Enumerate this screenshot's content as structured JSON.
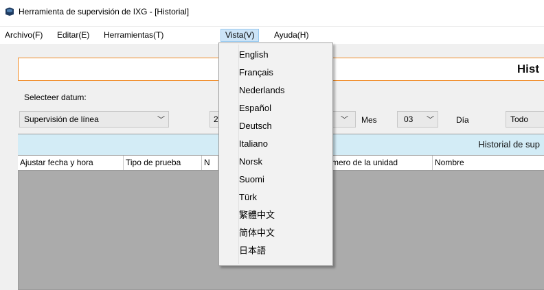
{
  "window": {
    "title": "Herramienta de supervisión de IXG - [Historial]",
    "icon": "app-icon"
  },
  "menubar": {
    "items": [
      {
        "label": "Archivo(F)"
      },
      {
        "label": "Editar(E)"
      },
      {
        "label": "Herramientas(T)"
      },
      {
        "label": "Vista(V)",
        "open": true
      },
      {
        "label": "Ayuda(H)"
      }
    ]
  },
  "language_menu": {
    "items": [
      "English",
      "Français",
      "Nederlands",
      "Español",
      "Deutsch",
      "Italiano",
      "Norsk",
      "Suomi",
      "Türk",
      "繁體中文",
      "简体中文",
      "日本語"
    ]
  },
  "banner": {
    "title": "Hist"
  },
  "filters": {
    "select_date_label": "Selecteer datum:",
    "type_value": "Supervisión de línea",
    "year_value": "2",
    "month_label": "Mes",
    "month_value": "03",
    "day_label": "Día",
    "day_value": "Todo"
  },
  "grid": {
    "caption": "Historial de sup",
    "columns": [
      "Ajustar fecha y hora",
      "Tipo de prueba",
      "N",
      "mero de la unidad",
      "Nombre"
    ]
  },
  "colors": {
    "banner_border": "#f08a24",
    "caption_bg": "#d3ecf6",
    "menu_highlight": "#cce4f7"
  }
}
